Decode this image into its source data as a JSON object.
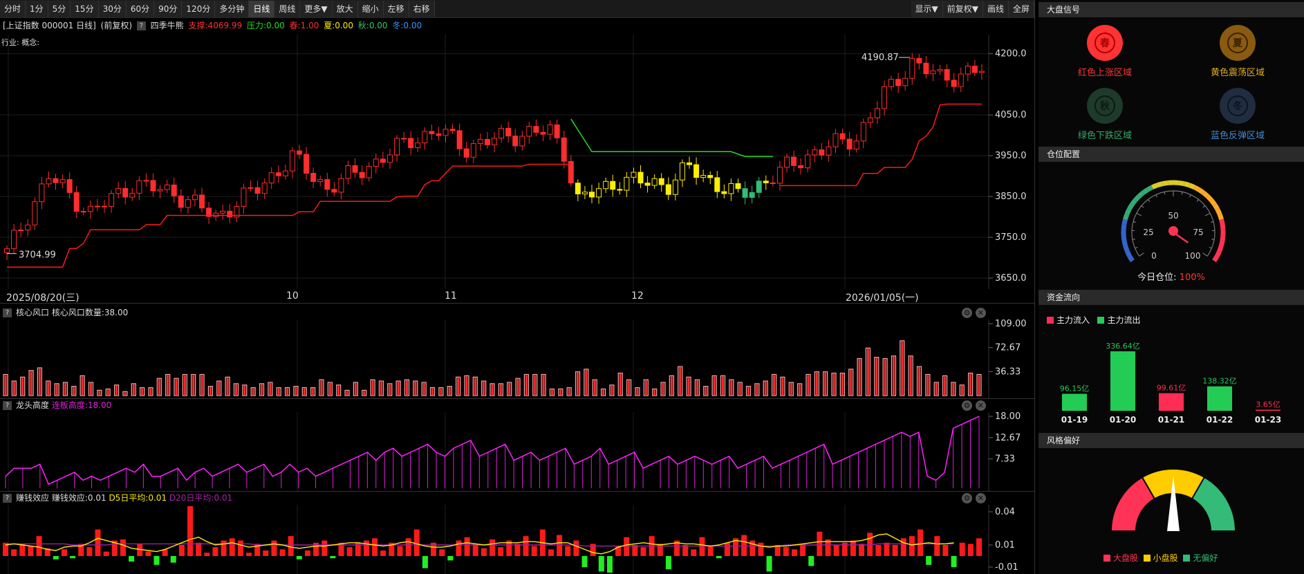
{
  "toolbar": {
    "left": [
      "分时",
      "1分",
      "5分",
      "15分",
      "30分",
      "60分",
      "90分",
      "120分",
      "多分钟",
      "日线",
      "周线",
      "更多▼",
      "放大",
      "缩小",
      "左移",
      "右移"
    ],
    "active": "日线",
    "right": [
      "显示▼",
      "前复权▼",
      "画线",
      "全屏"
    ]
  },
  "info": {
    "index_name": "[上证指数 000001 日线]",
    "adjust": "(前复权)",
    "help": "?",
    "indicator": "四季牛熊",
    "support": "支撑:4069.99",
    "pressure": "压力:0.00",
    "spring": "春:1.00",
    "summer": "夏:0.00",
    "autumn": "秋:0.00",
    "winter": "冬:0.00",
    "industry": "行业: 概念:"
  },
  "colors": {
    "red": "#ff2d2d",
    "green": "#22dd22",
    "yellow": "#ffee00",
    "teal": "#33bb77",
    "magenta": "#dd22dd",
    "pink_bar": "#ffaaaa",
    "axis_text": "#dddddd"
  },
  "main_chart": {
    "y_ticks": [
      "4200.0",
      "4050.0",
      "3950.0",
      "3850.0",
      "3750.0",
      "3650.0"
    ],
    "high_label": "4190.87",
    "low_label": "3704.99",
    "dates": [
      "2025/08/20(三)",
      "10",
      "11",
      "12",
      "2026/01/05(一)"
    ]
  },
  "chart_data": [
    {
      "type": "candlestick",
      "title": "四季牛熊",
      "ylim": [
        3640,
        4230
      ],
      "high": 4190.87,
      "low": 3704.99,
      "support": 4069.99
    },
    {
      "type": "bar",
      "title": "核心风口",
      "ylim": [
        0,
        109
      ],
      "series": [
        {
          "name": "核心风口数量",
          "values": [
            32,
            22,
            28,
            38,
            42,
            22,
            18,
            20,
            14,
            30,
            20,
            8,
            10,
            16,
            6,
            18,
            12,
            12,
            26,
            32,
            26,
            32,
            32,
            32,
            14,
            22,
            28,
            18,
            16,
            12,
            18,
            20,
            12,
            12,
            14,
            12,
            12,
            24,
            20,
            16,
            8,
            20,
            8,
            24,
            22,
            18,
            22,
            24,
            22,
            20,
            12,
            12,
            14,
            28,
            30,
            28,
            22,
            18,
            18,
            20,
            26,
            32,
            32,
            32,
            10,
            10,
            12,
            36,
            40,
            24,
            10,
            16,
            34,
            24,
            12,
            24,
            10,
            20,
            30,
            44,
            28,
            24,
            14,
            30,
            30,
            24,
            20,
            14,
            18,
            22,
            32,
            28,
            20,
            18,
            32,
            36,
            36,
            34,
            34,
            40,
            56,
            72,
            58,
            56,
            60,
            83,
            60,
            44,
            32,
            20,
            30,
            20,
            16,
            34,
            32
          ]
        }
      ]
    },
    {
      "type": "line",
      "title": "龙头高度",
      "ylim": [
        0,
        18
      ],
      "series": [
        {
          "name": "连板高度",
          "values": [
            3,
            5,
            5,
            5,
            6,
            1,
            2,
            3,
            4,
            2,
            3,
            2,
            3,
            4,
            5,
            4,
            6,
            3,
            3,
            4,
            5,
            2,
            4,
            5,
            3,
            4,
            5,
            6,
            4,
            5,
            6,
            3,
            4,
            6,
            4,
            5,
            3,
            4,
            5,
            6,
            7,
            8,
            9,
            7,
            9,
            10,
            8,
            9,
            10,
            11,
            9,
            8,
            10,
            11,
            12,
            8,
            9,
            10,
            11,
            7,
            8,
            9,
            7,
            8,
            9,
            10,
            6,
            7,
            8,
            10,
            6,
            7,
            8,
            9,
            5,
            6,
            7,
            8,
            6,
            7,
            8,
            7,
            6,
            7,
            8,
            5,
            6,
            7,
            8,
            5,
            6,
            7,
            8,
            9,
            10,
            11,
            6,
            7,
            8,
            9,
            10,
            11,
            12,
            13,
            14,
            13,
            14,
            3,
            2,
            4,
            15,
            16,
            17,
            18
          ]
        }
      ]
    },
    {
      "type": "bar",
      "title": "赚钱效应",
      "ylim": [
        -0.015,
        0.045
      ],
      "series": [
        {
          "name": "赚钱效应",
          "values": [
            0.012,
            0.006,
            0.011,
            0.009,
            0.018,
            0.007,
            -0.003,
            0.006,
            -0.002,
            0.011,
            0.008,
            0.024,
            0.004,
            0.014,
            0.015,
            -0.005,
            0.011,
            0.004,
            -0.008,
            0.006,
            -0.006,
            0.01,
            0.045,
            0.012,
            0.003,
            0.008,
            0.014,
            0.016,
            0.014,
            0.003,
            0.011,
            0.005,
            0.014,
            0.006,
            0.018,
            -0.003,
            0.005,
            0.012,
            0.014,
            -0.002,
            0.012,
            0.008,
            0.012,
            0.014,
            0.016,
            0.005,
            0.012,
            0.009,
            0.016,
            0.024,
            -0.011,
            0.012,
            0.006,
            -0.004,
            0.014,
            0.017,
            0.011,
            0.007,
            0.015,
            0.008,
            0.014,
            0.011,
            0.018,
            0.009,
            0.024,
            0.006,
            0.019,
            0.009,
            0.014,
            -0.01,
            0.011,
            -0.014,
            -0.015,
            0.009,
            0.017,
            0.01,
            0.008,
            0.018,
            0.011,
            -0.012,
            0.014,
            0.01,
            0.006,
            0.017,
            0.009,
            -0.002,
            0.012,
            0.016,
            0.019,
            0.014,
            0.012,
            -0.014,
            0.01,
            0.008,
            0.006,
            0.011,
            -0.009,
            0.022,
            0.015,
            0.01,
            0.012,
            0.014,
            0.011,
            0.021,
            0.01,
            0.012,
            0.01,
            0.016,
            0.018,
            0.024,
            -0.008,
            0.018,
            0.01,
            -0.01,
            0.012,
            0.011,
            0.016
          ]
        },
        {
          "name": "D5日平均",
          "values": [
            0.01,
            0.011,
            0.01,
            0.009,
            0.008,
            0.006,
            0.005,
            0.008,
            0.009,
            0.009,
            0.012,
            0.016,
            0.014,
            0.012,
            0.01,
            0.007,
            0.006,
            0.005,
            0.004,
            0.006,
            0.009,
            0.012,
            0.015,
            0.017,
            0.013,
            0.01,
            0.011,
            0.012,
            0.01,
            0.008,
            0.009,
            0.01,
            0.011,
            0.01,
            0.008,
            0.007,
            0.008,
            0.009,
            0.009,
            0.01,
            0.011,
            0.012,
            0.012,
            0.011,
            0.01,
            0.009,
            0.01,
            0.012,
            0.013,
            0.011,
            0.009,
            0.008,
            0.008,
            0.009,
            0.011,
            0.012,
            0.011,
            0.01,
            0.011,
            0.012,
            0.012,
            0.012,
            0.013,
            0.013,
            0.012,
            0.011,
            0.012,
            0.012,
            0.009,
            0.006,
            0.003,
            0.002,
            0.004,
            0.008,
            0.01,
            0.011,
            0.012,
            0.011,
            0.01,
            0.011,
            0.012,
            0.011,
            0.011,
            0.01,
            0.009,
            0.01,
            0.012,
            0.014,
            0.013,
            0.011,
            0.009,
            0.008,
            0.009,
            0.009,
            0.01,
            0.011,
            0.012,
            0.013,
            0.013,
            0.013,
            0.013,
            0.013,
            0.014,
            0.016,
            0.019,
            0.02,
            0.016,
            0.012,
            0.01,
            0.011,
            0.012,
            0.011,
            0.011,
            0.012
          ]
        },
        {
          "name": "D20日平均",
          "values": [
            0.011,
            0.011,
            0.011,
            0.011,
            0.011,
            0.011,
            0.011,
            0.011,
            0.01,
            0.01,
            0.01,
            0.01,
            0.01,
            0.011,
            0.011,
            0.011,
            0.011,
            0.011,
            0.011,
            0.011,
            0.011,
            0.011,
            0.011,
            0.011,
            0.011,
            0.011,
            0.011,
            0.011,
            0.011,
            0.011,
            0.01,
            0.01,
            0.01,
            0.01,
            0.01,
            0.01,
            0.01,
            0.01,
            0.01,
            0.01,
            0.01,
            0.01,
            0.01,
            0.01,
            0.01,
            0.01,
            0.01,
            0.01,
            0.01,
            0.01,
            0.01,
            0.01,
            0.01,
            0.01,
            0.01,
            0.01,
            0.01,
            0.01,
            0.01,
            0.01,
            0.01,
            0.01,
            0.01,
            0.01,
            0.01,
            0.01,
            0.01,
            0.01,
            0.01,
            0.009,
            0.009,
            0.009,
            0.009,
            0.009,
            0.009,
            0.009,
            0.009,
            0.009,
            0.009,
            0.009,
            0.009,
            0.009,
            0.009,
            0.009,
            0.009,
            0.009,
            0.009,
            0.009,
            0.009,
            0.009,
            0.009,
            0.009,
            0.009,
            0.01,
            0.01,
            0.01,
            0.01,
            0.01,
            0.01,
            0.01,
            0.01,
            0.01,
            0.01,
            0.01,
            0.011,
            0.011,
            0.011,
            0.011,
            0.011,
            0.011,
            0.011,
            0.011,
            0.011,
            0.011
          ]
        }
      ]
    },
    {
      "type": "bar",
      "title": "资金流向",
      "categories": [
        "01-19",
        "01-20",
        "01-21",
        "01-22",
        "01-23"
      ],
      "values": [
        96.15,
        336.64,
        99.61,
        138.32,
        3.65
      ],
      "labels": [
        "96.15亿",
        "336.64亿",
        "99.61亿",
        "138.32亿",
        "3.65亿"
      ],
      "directions": [
        "out",
        "out",
        "in",
        "out",
        "in"
      ]
    }
  ],
  "panels": {
    "core": {
      "help": "?",
      "name": "核心风口",
      "value": "核心风口数量:38.00",
      "ticks": [
        "109.00",
        "72.67",
        "36.33"
      ]
    },
    "dragon": {
      "help": "?",
      "name": "龙头高度",
      "value": "连板高度:18.00",
      "ticks": [
        "18.00",
        "12.67",
        "7.33"
      ]
    },
    "profit": {
      "help": "?",
      "name": "赚钱效应",
      "value": "赚钱效应:0.01",
      "d5": "D5日平均:0.01",
      "d20": "D20日平均:0.01",
      "ticks": [
        "0.04",
        "0.01",
        "-0.01"
      ]
    }
  },
  "sidebar": {
    "signal_title": "大盘信号",
    "seasons": [
      {
        "char": "春",
        "label": "红色上涨区域",
        "color": "#ff3333",
        "active": true
      },
      {
        "char": "夏",
        "label": "黄色震荡区域",
        "color": "#ddaa22",
        "active": false
      },
      {
        "char": "秋",
        "label": "绿色下跌区域",
        "color": "#33aa66",
        "active": false
      },
      {
        "char": "冬",
        "label": "蓝色反弹区域",
        "color": "#4488cc",
        "active": false
      }
    ],
    "position_title": "仓位配置",
    "gauge_ticks": [
      "0",
      "25",
      "50",
      "75",
      "100"
    ],
    "position_label": "今日仓位:",
    "position_value": "100%",
    "position_fraction": 1.0,
    "flow_title": "资金流向",
    "flow_in": "主力流入",
    "flow_out": "主力流出",
    "style_title": "风格偏好",
    "style_legend": [
      {
        "label": "大盘股",
        "color": "#ff3355"
      },
      {
        "label": "小盘股",
        "color": "#ffcc00"
      },
      {
        "label": "无偏好",
        "color": "#33bb77"
      }
    ]
  }
}
